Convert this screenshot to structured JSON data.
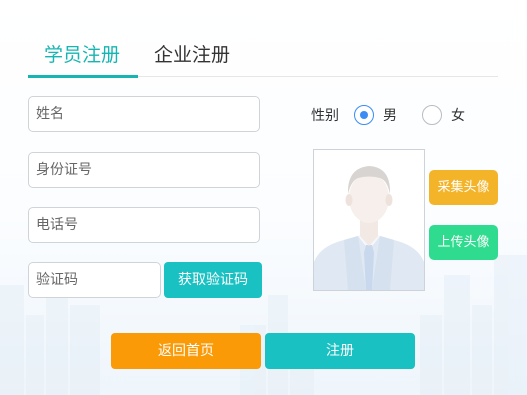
{
  "tabs": {
    "student": "学员注册",
    "company": "企业注册"
  },
  "form": {
    "name_placeholder": "姓名",
    "id_placeholder": "身份证号",
    "phone_placeholder": "电话号",
    "code_placeholder": "验证码",
    "get_code_label": "获取验证码"
  },
  "gender": {
    "label": "性别",
    "male": "男",
    "female": "女",
    "selected": "男"
  },
  "avatar": {
    "capture_label": "采集头像",
    "upload_label": "上传头像"
  },
  "actions": {
    "back_label": "返回首页",
    "register_label": "注册"
  },
  "colors": {
    "accent": "#17b5b2",
    "radio_selected": "#3b8cf5",
    "capture_button": "#f4b42a",
    "upload_button": "#2fdc8f",
    "back_button": "#fb9a07",
    "register_button": "#1ac1c2"
  }
}
